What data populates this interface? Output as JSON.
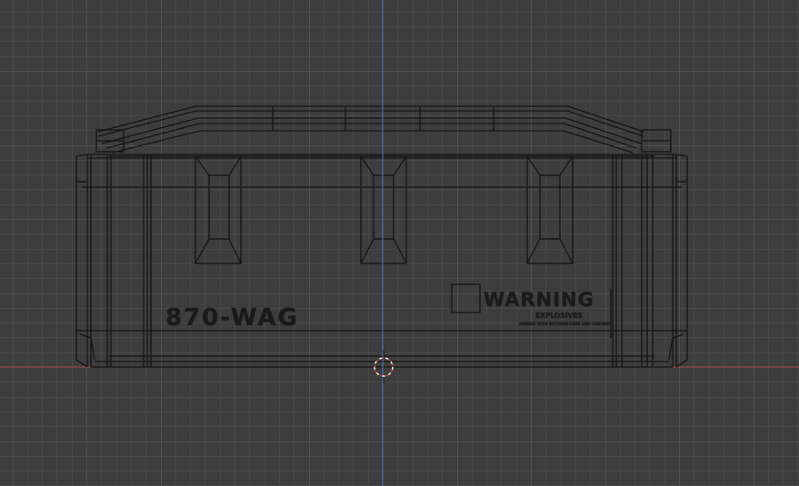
{
  "viewport": {
    "background_color": "#3d3d3d",
    "grid_minor_color": "#474747",
    "grid_major_color": "#515151",
    "z_axis_color": "#4a73c9",
    "x_axis_color": "#a84a55",
    "wire_color": "#151515",
    "cursor_icon": "3d-cursor-icon"
  },
  "model": {
    "id_label": "870-WAG",
    "warning_title": "WARNING",
    "warning_subtitle": "EXPLOSIVES",
    "warning_fine_print": "HANDLE WITH EXTREME CARE AND CAUTION"
  }
}
